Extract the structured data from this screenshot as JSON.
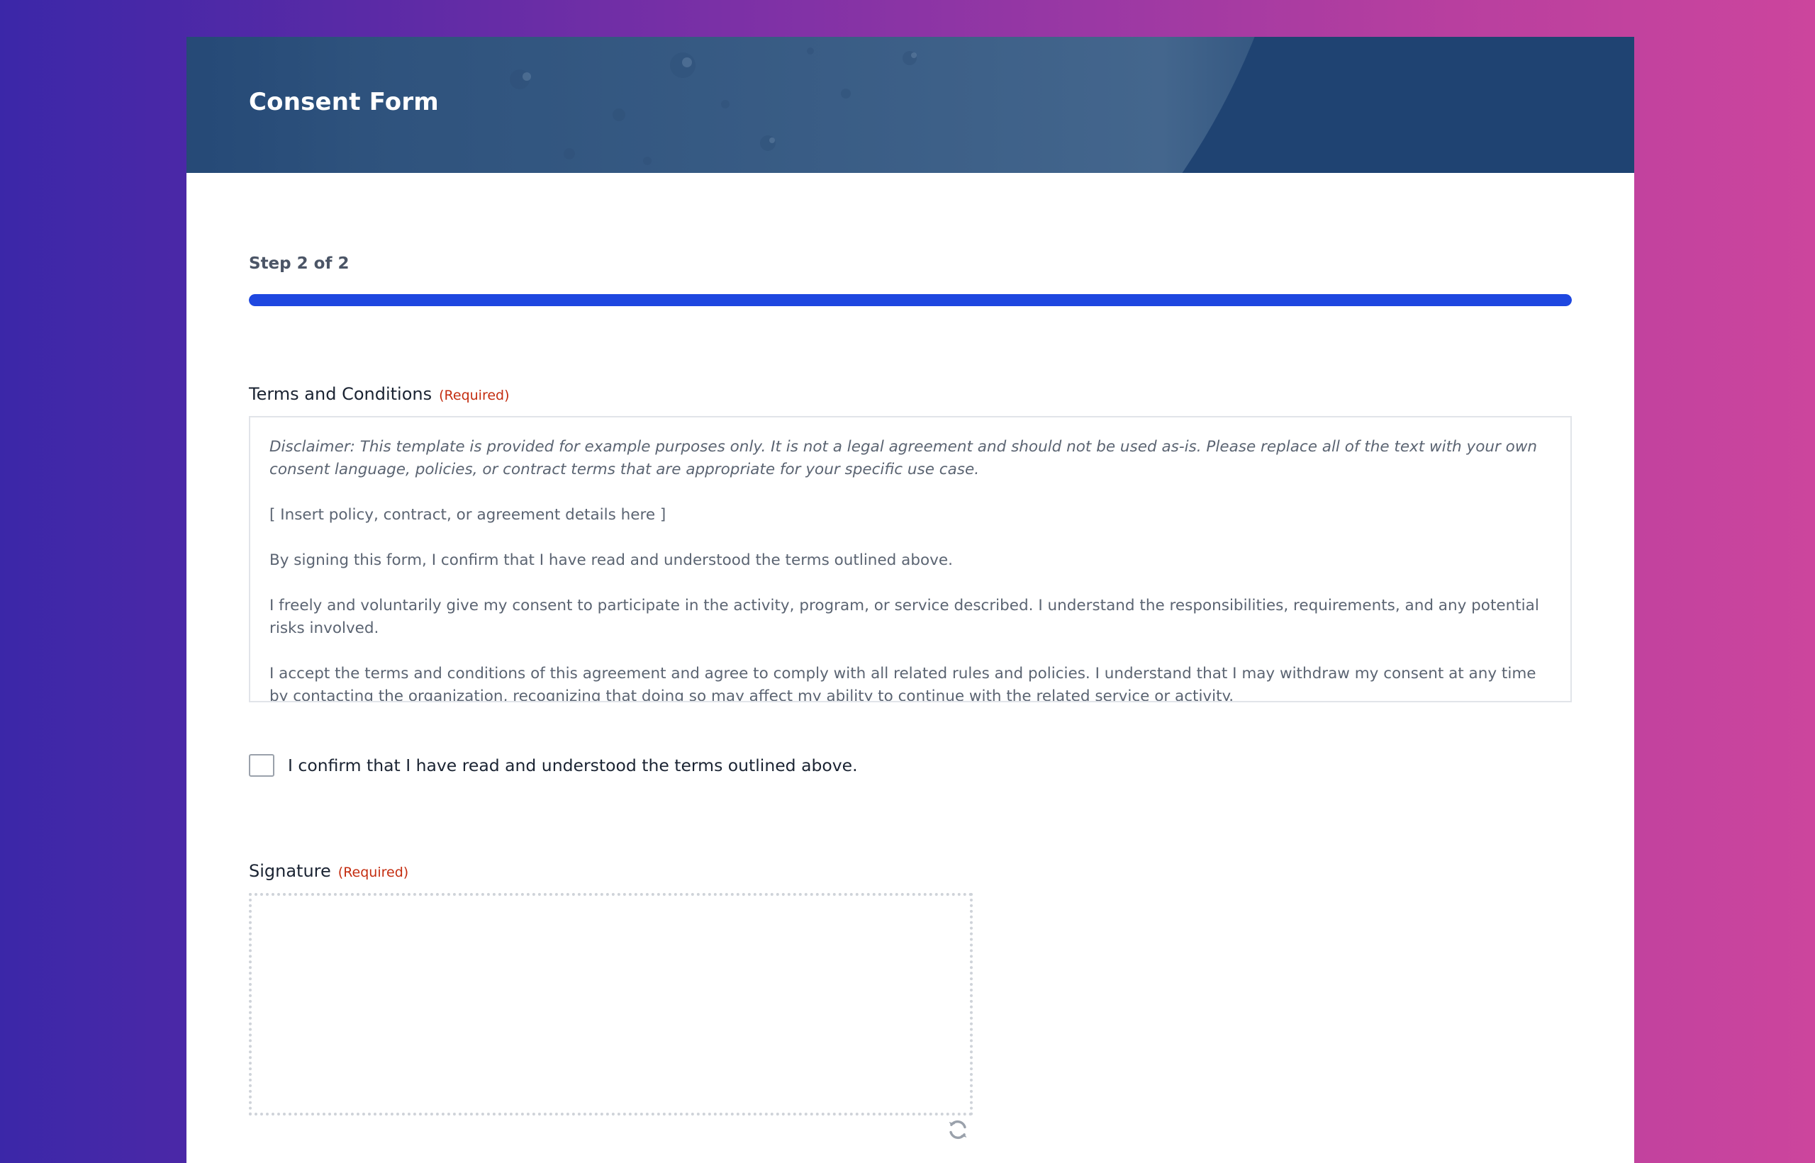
{
  "form": {
    "title": "Consent Form"
  },
  "progress": {
    "label": "Step 2 of 2",
    "percent": 100,
    "color": "#1e47e0"
  },
  "terms": {
    "label": "Terms and Conditions",
    "required": "(Required)",
    "paragraphs": [
      "Disclaimer: This template is provided for example purposes only. It is not a legal agreement and should not be used as-is. Please replace all of the text with your own consent language, policies, or contract terms that are appropriate for your specific use case.",
      "[ Insert policy, contract, or agreement details here ]",
      "By signing this form, I confirm that I have read and understood the terms outlined above.",
      "I freely and voluntarily give my consent to participate in the activity, program, or service described. I understand the responsibilities, requirements, and any potential risks involved.",
      "I accept the terms and conditions of this agreement and agree to comply with all related rules and policies. I understand that I may withdraw my consent at any time by contacting the organization, recognizing that doing so may affect my ability to continue with the related service or activity."
    ]
  },
  "confirm": {
    "label": "I confirm that I have read and understood the terms outlined above.",
    "checked": false
  },
  "signature": {
    "label": "Signature",
    "required": "(Required)",
    "reset_icon": "refresh-icon"
  },
  "colors": {
    "header_bg": "#1f4372",
    "required": "#c42d10",
    "accent": "#1e47e0"
  }
}
